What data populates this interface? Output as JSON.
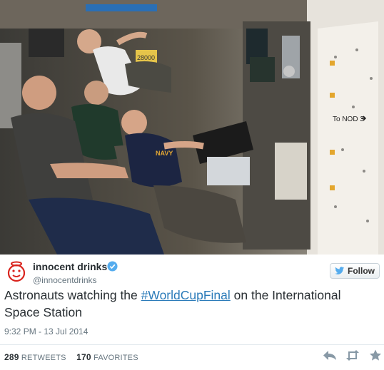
{
  "tweet": {
    "author": {
      "display_name": "innocent drinks",
      "handle": "@innocentdrinks",
      "verified": true
    },
    "follow_label": "Follow",
    "text_before": "Astronauts watching the ",
    "hashtag": "#WorldCupFinal",
    "text_after": " on the International Space Station",
    "timestamp": "9:32 PM - 13 Jul 2014",
    "retweets_count": "289",
    "retweets_label": "RETWEETS",
    "favorites_count": "170",
    "favorites_label": "FAVORITES"
  },
  "photo": {
    "sign_text": "To NOD 3",
    "panel_number": "28000"
  },
  "icons": {
    "avatar": "innocent-logo-icon",
    "verified": "verified-badge-icon",
    "follow": "twitter-bird-icon",
    "reply": "reply-icon",
    "retweet": "retweet-icon",
    "favorite": "star-icon"
  },
  "colors": {
    "link": "#2b7bb9",
    "verified": "#55acee",
    "avatar_red": "#d9231d",
    "muted": "#66757f"
  }
}
